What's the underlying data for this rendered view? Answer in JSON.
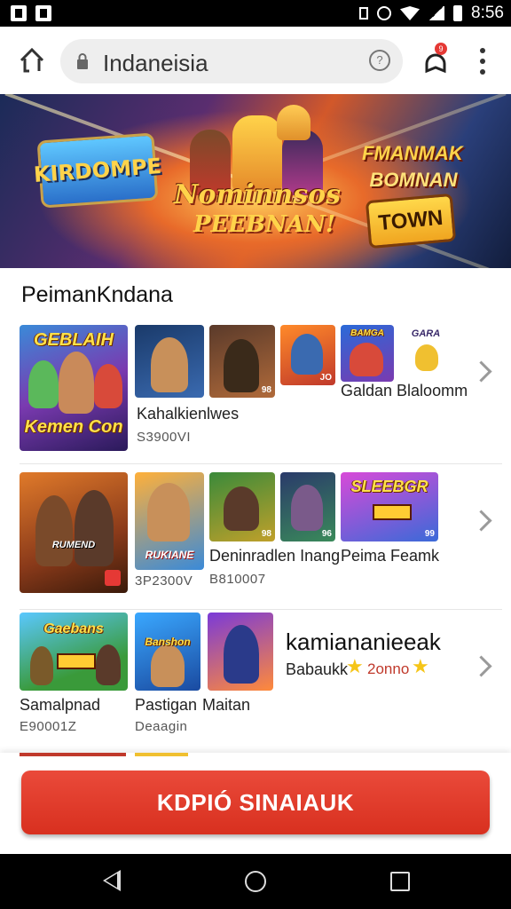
{
  "status_bar": {
    "time": "8:56"
  },
  "browser": {
    "url": "Indaneisia",
    "notification_count": "9"
  },
  "banner": {
    "logo_text": "KIRDOMPE",
    "title_line1": "Nominnsos",
    "title_line2": "PEEBNAN!",
    "right_line1": "FMANMAK",
    "right_line2": "BOMNAN",
    "cta_text": "TOWN"
  },
  "section": {
    "title": "PeimanKndana"
  },
  "rows": [
    {
      "big_tile": {
        "text_top": "GEBLAIH",
        "text_bottom": "Kemen Con"
      },
      "tiles": [
        {
          "text": ""
        },
        {
          "text": "",
          "corner": "98"
        },
        {
          "text": "",
          "corner": "JO"
        },
        {
          "text": "BAMGA"
        }
      ],
      "extra_tile": {
        "text": "GARA"
      },
      "label1": "Kahalkienlwes",
      "sub1": "S3900VI",
      "label2": "Galdan Blaloomm"
    },
    {
      "big_tile": {
        "text_top": "RUMEND",
        "text_bottom": ""
      },
      "tiles": [
        {
          "text": "RUKIANE"
        },
        {
          "text": "",
          "corner": "98"
        },
        {
          "text": "",
          "corner": "96"
        },
        {
          "text": "SLEEBGR",
          "corner": "99"
        }
      ],
      "label1": "Deninradlen Inang",
      "label2": "Peima Feamk",
      "sub1": "3P2300V",
      "sub2": "B810007"
    },
    {
      "big_tile": {
        "text_top": "Gaebans"
      },
      "tiles": [
        {
          "text": "Banshon"
        },
        {
          "text": ""
        }
      ],
      "label1": "Samalpnad",
      "sub1": "E90001Z",
      "label2": "Pastigan",
      "label3": "Maitan",
      "sub2": "Deaagin",
      "feature_title": "kamiananieeak",
      "feature_sub": "Babaukk",
      "feature_rating": "2onno"
    }
  ],
  "cta": {
    "label": "KDPIÓ SINAIAUK"
  },
  "colors": {
    "accent": "#dc3422",
    "status_bar": "#000000",
    "nav_bar": "#000000"
  },
  "icons": [
    "home-icon",
    "lock-icon",
    "info-icon",
    "extension-icon",
    "more-vert-icon",
    "chevron-right-icon",
    "star-icon",
    "back-icon",
    "home-nav-icon",
    "recents-icon"
  ]
}
